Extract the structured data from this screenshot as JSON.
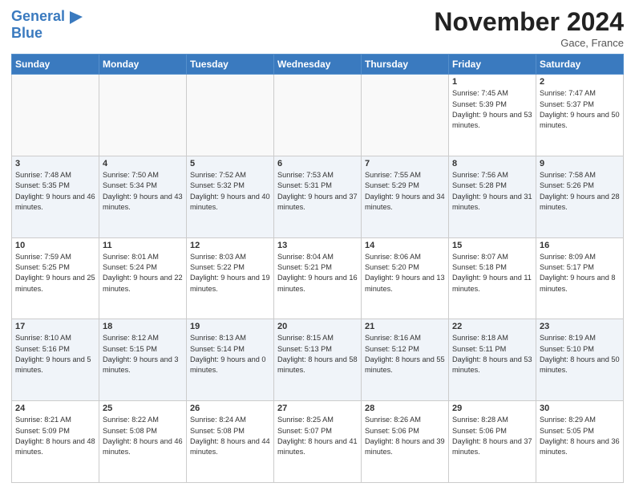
{
  "logo": {
    "line1": "General",
    "line2": "Blue"
  },
  "header": {
    "month": "November 2024",
    "location": "Gace, France"
  },
  "days_of_week": [
    "Sunday",
    "Monday",
    "Tuesday",
    "Wednesday",
    "Thursday",
    "Friday",
    "Saturday"
  ],
  "weeks": [
    [
      {
        "day": "",
        "info": ""
      },
      {
        "day": "",
        "info": ""
      },
      {
        "day": "",
        "info": ""
      },
      {
        "day": "",
        "info": ""
      },
      {
        "day": "",
        "info": ""
      },
      {
        "day": "1",
        "info": "Sunrise: 7:45 AM\nSunset: 5:39 PM\nDaylight: 9 hours and 53 minutes."
      },
      {
        "day": "2",
        "info": "Sunrise: 7:47 AM\nSunset: 5:37 PM\nDaylight: 9 hours and 50 minutes."
      }
    ],
    [
      {
        "day": "3",
        "info": "Sunrise: 7:48 AM\nSunset: 5:35 PM\nDaylight: 9 hours and 46 minutes."
      },
      {
        "day": "4",
        "info": "Sunrise: 7:50 AM\nSunset: 5:34 PM\nDaylight: 9 hours and 43 minutes."
      },
      {
        "day": "5",
        "info": "Sunrise: 7:52 AM\nSunset: 5:32 PM\nDaylight: 9 hours and 40 minutes."
      },
      {
        "day": "6",
        "info": "Sunrise: 7:53 AM\nSunset: 5:31 PM\nDaylight: 9 hours and 37 minutes."
      },
      {
        "day": "7",
        "info": "Sunrise: 7:55 AM\nSunset: 5:29 PM\nDaylight: 9 hours and 34 minutes."
      },
      {
        "day": "8",
        "info": "Sunrise: 7:56 AM\nSunset: 5:28 PM\nDaylight: 9 hours and 31 minutes."
      },
      {
        "day": "9",
        "info": "Sunrise: 7:58 AM\nSunset: 5:26 PM\nDaylight: 9 hours and 28 minutes."
      }
    ],
    [
      {
        "day": "10",
        "info": "Sunrise: 7:59 AM\nSunset: 5:25 PM\nDaylight: 9 hours and 25 minutes."
      },
      {
        "day": "11",
        "info": "Sunrise: 8:01 AM\nSunset: 5:24 PM\nDaylight: 9 hours and 22 minutes."
      },
      {
        "day": "12",
        "info": "Sunrise: 8:03 AM\nSunset: 5:22 PM\nDaylight: 9 hours and 19 minutes."
      },
      {
        "day": "13",
        "info": "Sunrise: 8:04 AM\nSunset: 5:21 PM\nDaylight: 9 hours and 16 minutes."
      },
      {
        "day": "14",
        "info": "Sunrise: 8:06 AM\nSunset: 5:20 PM\nDaylight: 9 hours and 13 minutes."
      },
      {
        "day": "15",
        "info": "Sunrise: 8:07 AM\nSunset: 5:18 PM\nDaylight: 9 hours and 11 minutes."
      },
      {
        "day": "16",
        "info": "Sunrise: 8:09 AM\nSunset: 5:17 PM\nDaylight: 9 hours and 8 minutes."
      }
    ],
    [
      {
        "day": "17",
        "info": "Sunrise: 8:10 AM\nSunset: 5:16 PM\nDaylight: 9 hours and 5 minutes."
      },
      {
        "day": "18",
        "info": "Sunrise: 8:12 AM\nSunset: 5:15 PM\nDaylight: 9 hours and 3 minutes."
      },
      {
        "day": "19",
        "info": "Sunrise: 8:13 AM\nSunset: 5:14 PM\nDaylight: 9 hours and 0 minutes."
      },
      {
        "day": "20",
        "info": "Sunrise: 8:15 AM\nSunset: 5:13 PM\nDaylight: 8 hours and 58 minutes."
      },
      {
        "day": "21",
        "info": "Sunrise: 8:16 AM\nSunset: 5:12 PM\nDaylight: 8 hours and 55 minutes."
      },
      {
        "day": "22",
        "info": "Sunrise: 8:18 AM\nSunset: 5:11 PM\nDaylight: 8 hours and 53 minutes."
      },
      {
        "day": "23",
        "info": "Sunrise: 8:19 AM\nSunset: 5:10 PM\nDaylight: 8 hours and 50 minutes."
      }
    ],
    [
      {
        "day": "24",
        "info": "Sunrise: 8:21 AM\nSunset: 5:09 PM\nDaylight: 8 hours and 48 minutes."
      },
      {
        "day": "25",
        "info": "Sunrise: 8:22 AM\nSunset: 5:08 PM\nDaylight: 8 hours and 46 minutes."
      },
      {
        "day": "26",
        "info": "Sunrise: 8:24 AM\nSunset: 5:08 PM\nDaylight: 8 hours and 44 minutes."
      },
      {
        "day": "27",
        "info": "Sunrise: 8:25 AM\nSunset: 5:07 PM\nDaylight: 8 hours and 41 minutes."
      },
      {
        "day": "28",
        "info": "Sunrise: 8:26 AM\nSunset: 5:06 PM\nDaylight: 8 hours and 39 minutes."
      },
      {
        "day": "29",
        "info": "Sunrise: 8:28 AM\nSunset: 5:06 PM\nDaylight: 8 hours and 37 minutes."
      },
      {
        "day": "30",
        "info": "Sunrise: 8:29 AM\nSunset: 5:05 PM\nDaylight: 8 hours and 36 minutes."
      }
    ]
  ]
}
